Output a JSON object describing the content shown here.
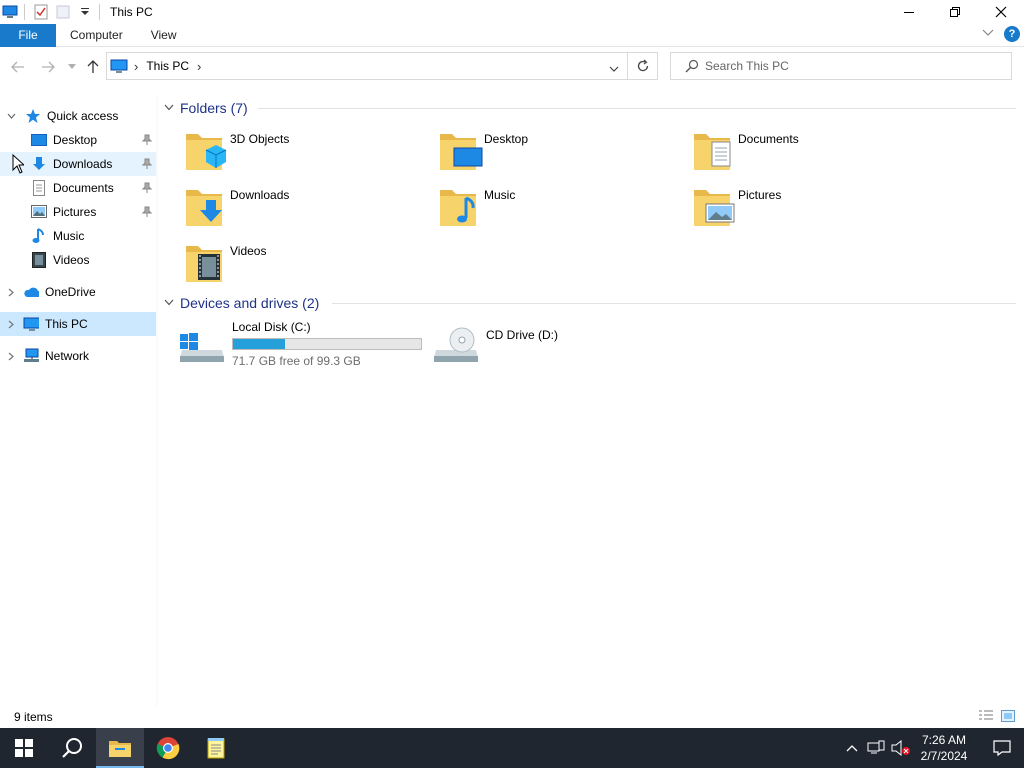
{
  "window": {
    "title": "This PC"
  },
  "ribbon": {
    "tabs": [
      {
        "label": "File"
      },
      {
        "label": "Computer"
      },
      {
        "label": "View"
      }
    ],
    "help_label": "?"
  },
  "address_bar": {
    "path": [
      "This PC"
    ],
    "separator": "›"
  },
  "search": {
    "placeholder": "Search This PC"
  },
  "sidebar": {
    "items": [
      {
        "label": "Quick access",
        "icon": "star-icon"
      },
      {
        "label": "Desktop",
        "icon": "desktop-icon",
        "pinned": true
      },
      {
        "label": "Downloads",
        "icon": "downloads-icon",
        "pinned": true
      },
      {
        "label": "Documents",
        "icon": "documents-icon",
        "pinned": true
      },
      {
        "label": "Pictures",
        "icon": "pictures-icon",
        "pinned": true
      },
      {
        "label": "Music",
        "icon": "music-icon"
      },
      {
        "label": "Videos",
        "icon": "videos-icon"
      },
      {
        "label": "OneDrive",
        "icon": "onedrive-icon"
      },
      {
        "label": "This PC",
        "icon": "this-pc-icon",
        "selected": true
      },
      {
        "label": "Network",
        "icon": "network-icon"
      }
    ]
  },
  "folders": {
    "header": "Folders (7)",
    "items": [
      {
        "label": "3D Objects",
        "icon": "3d-objects-icon"
      },
      {
        "label": "Desktop",
        "icon": "desktop-folder-icon"
      },
      {
        "label": "Documents",
        "icon": "documents-folder-icon"
      },
      {
        "label": "Downloads",
        "icon": "downloads-folder-icon"
      },
      {
        "label": "Music",
        "icon": "music-folder-icon"
      },
      {
        "label": "Pictures",
        "icon": "pictures-folder-icon"
      },
      {
        "label": "Videos",
        "icon": "videos-folder-icon"
      }
    ]
  },
  "drives": {
    "header": "Devices and drives (2)",
    "items": [
      {
        "label": "Local Disk (C:)",
        "free_text": "71.7 GB free of 99.3 GB",
        "used_fraction": 0.278,
        "icon": "hard-drive-icon"
      },
      {
        "label": "CD Drive (D:)",
        "icon": "cd-drive-icon"
      }
    ]
  },
  "status": {
    "item_count": "9 items"
  },
  "taskbar": {
    "time": "7:26 AM",
    "date": "2/7/2024"
  },
  "colors": {
    "accent": "#1979ca",
    "selection": "#cce8ff",
    "progress": "#26a0da",
    "taskbar": "#1f2630",
    "group_header": "#1e3287"
  }
}
